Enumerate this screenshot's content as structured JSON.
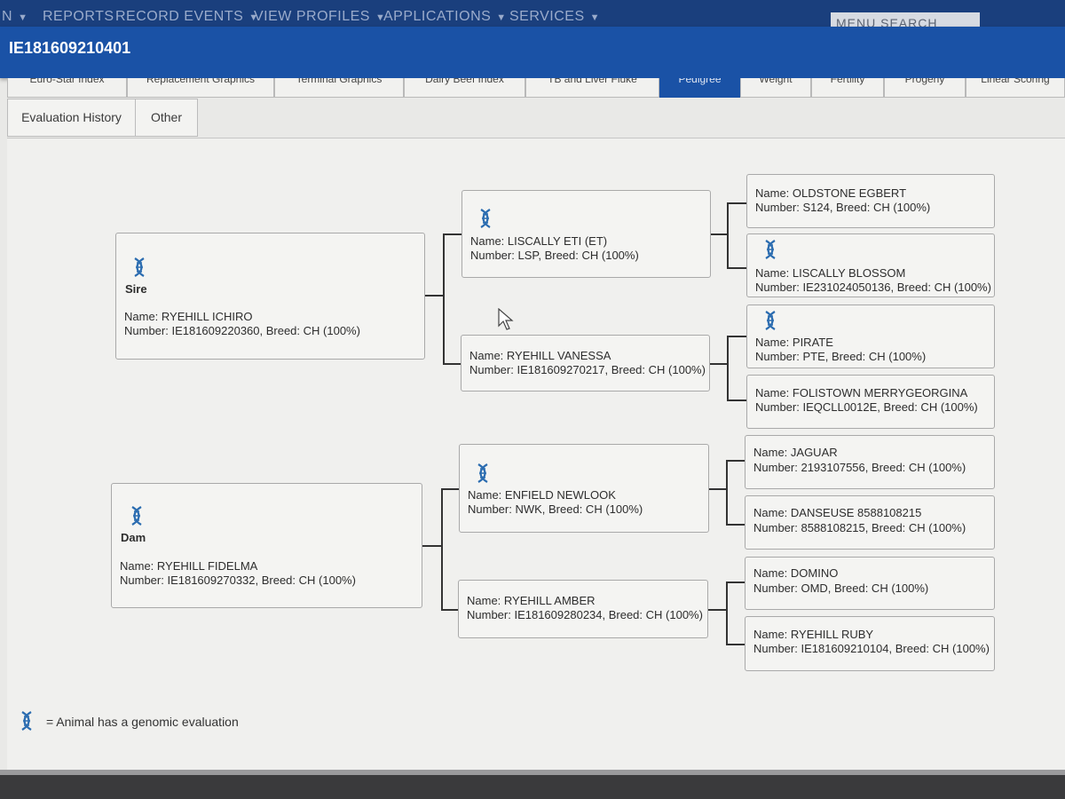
{
  "nav": {
    "items": [
      "N",
      "REPORTS",
      "RECORD EVENTS",
      "VIEW PROFILES",
      "APPLICATIONS",
      "SERVICES"
    ],
    "search_label": "MENU SEARCH"
  },
  "header": {
    "animal_id": "IE181609210401"
  },
  "tabs": [
    {
      "label": "Euro-Star Index"
    },
    {
      "label": "Replacement Graphics"
    },
    {
      "label": "Terminal Graphics"
    },
    {
      "label": "Dairy Beef Index"
    },
    {
      "label": "TB and Liver Fluke"
    },
    {
      "label": "Pedigree",
      "active": true
    },
    {
      "label": "Weight"
    },
    {
      "label": "Fertility"
    },
    {
      "label": "Progeny"
    },
    {
      "label": "Linear Scoring"
    }
  ],
  "subtabs": [
    {
      "label": "Evaluation History"
    },
    {
      "label": "Other"
    }
  ],
  "pedigree": {
    "sire": {
      "role": "Sire",
      "genomic": true,
      "name": "Name: RYEHILL ICHIRO",
      "number": "Number: IE181609220360, Breed: CH (100%)"
    },
    "dam": {
      "role": "Dam",
      "genomic": true,
      "name": "Name: RYEHILL FIDELMA",
      "number": "Number: IE181609270332, Breed: CH (100%)"
    },
    "sire_sire": {
      "genomic": true,
      "name": "Name: LISCALLY ETI (ET)",
      "number": "Number: LSP, Breed: CH (100%)"
    },
    "sire_dam": {
      "genomic": false,
      "name": "Name: RYEHILL VANESSA",
      "number": "Number: IE181609270217, Breed: CH (100%)"
    },
    "dam_sire": {
      "genomic": true,
      "name": "Name: ENFIELD NEWLOOK",
      "number": "Number: NWK, Breed: CH (100%)"
    },
    "dam_dam": {
      "genomic": false,
      "name": "Name: RYEHILL AMBER",
      "number": "Number: IE181609280234, Breed: CH (100%)"
    },
    "ss_sire": {
      "genomic": false,
      "name": "Name: OLDSTONE EGBERT",
      "number": "Number: S124, Breed: CH (100%)"
    },
    "ss_dam": {
      "genomic": true,
      "name": "Name: LISCALLY BLOSSOM",
      "number": "Number: IE231024050136, Breed: CH (100%)"
    },
    "sd_sire": {
      "genomic": true,
      "name": "Name: PIRATE",
      "number": "Number: PTE, Breed: CH (100%)"
    },
    "sd_dam": {
      "genomic": false,
      "name": "Name: FOLISTOWN MERRYGEORGINA",
      "number": "Number: IEQCLL0012E, Breed: CH (100%)"
    },
    "ds_sire": {
      "genomic": false,
      "name": "Name: JAGUAR",
      "number": "Number: 2193107556, Breed: CH (100%)"
    },
    "ds_dam": {
      "genomic": false,
      "name": "Name: DANSEUSE 8588108215",
      "number": "Number: 8588108215, Breed: CH (100%)"
    },
    "dd_sire": {
      "genomic": false,
      "name": "Name: DOMINO",
      "number": "Number: OMD, Breed: CH (100%)"
    },
    "dd_dam": {
      "genomic": false,
      "name": "Name: RYEHILL RUBY",
      "number": "Number: IE181609210104, Breed: CH (100%)"
    }
  },
  "legend": {
    "text": "= Animal has a genomic evaluation"
  },
  "colors": {
    "nav_bg": "#1a3f7d",
    "title_bg": "#1a52a6",
    "active_tab": "#1a52a6",
    "icon_blue": "#2b6cb0"
  }
}
